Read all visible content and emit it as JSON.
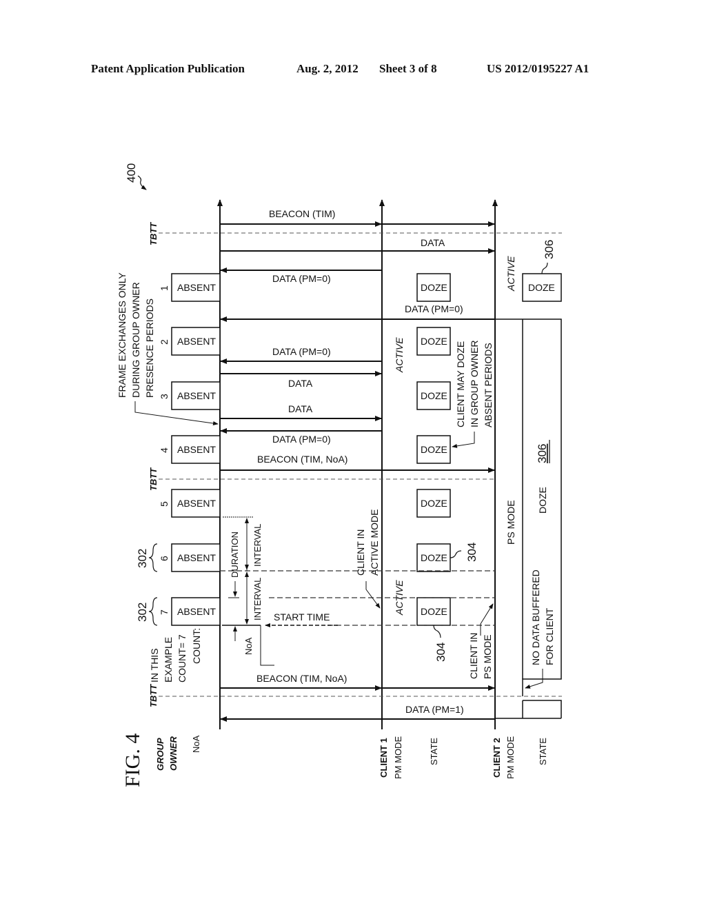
{
  "header": {
    "publication": "Patent Application Publication",
    "date": "Aug. 2, 2012",
    "sheet": "Sheet 3 of 8",
    "number": "US 2012/0195227 A1"
  },
  "figure": {
    "label": "FIG. 4",
    "ref_number": "400",
    "lanes": {
      "group_owner": [
        "GROUP",
        "OWNER"
      ],
      "noa": "NoA",
      "client1": "CLIENT 1",
      "client1_pm": "PM MODE",
      "client1_state": "STATE",
      "client2": "CLIENT 2",
      "client2_pm": "PM MODE",
      "client2_state": "STATE"
    },
    "tbtt": "TBTT",
    "absent_periods": [
      {
        "index": "1",
        "label": "ABSENT"
      },
      {
        "index": "2",
        "label": "ABSENT"
      },
      {
        "index": "3",
        "label": "ABSENT"
      },
      {
        "index": "4",
        "label": "ABSENT"
      },
      {
        "index": "5",
        "label": "ABSENT"
      },
      {
        "index": "6",
        "label": "ABSENT"
      },
      {
        "index": "7",
        "label": "ABSENT"
      }
    ],
    "doze_label": "DOZE",
    "messages": {
      "beacon_tim": "BEACON (TIM)",
      "data_top": "DATA",
      "data_pm0_1": "DATA (PM=0)",
      "data_pm0_c2": "DATA (PM=0)",
      "data_pm0_2": "DATA (PM=0)",
      "data_1": "DATA",
      "data_2": "DATA",
      "data_pm0_3": "DATA (PM=0)",
      "beacon_tim_noa_1": "BEACON (TIM, NoA)",
      "beacon_tim_noa_2": "BEACON (TIM, NoA)",
      "data_pm1": "DATA (PM=1)"
    },
    "annotations": {
      "frame_exchanges": [
        "FRAME EXCHANGES ONLY",
        "DURING GROUP OWNER",
        "PRESENCE PERIODS"
      ],
      "client_may_doze": [
        "CLIENT MAY DOZE",
        "IN GROUP OWNER",
        "ABSENT PERIODS"
      ],
      "client_active_mode": [
        "CLIENT IN",
        "ACTIVE MODE"
      ],
      "client_ps_mode": [
        "CLIENT IN",
        "PS MODE"
      ],
      "no_data_buffered": [
        "NO DATA BUFFERED",
        "FOR CLIENT"
      ],
      "example_count": [
        "IN THIS",
        "EXAMPLE",
        "COUNT= 7"
      ],
      "count": "COUNT:",
      "duration": "DURATION",
      "interval": "INTERVAL",
      "start_time": "START TIME",
      "noa_bracket": "NoA",
      "active": "ACTIVE",
      "ps_mode": "PS MODE",
      "doze_long": "DOZE",
      "ref_302": "302",
      "ref_304": "304",
      "ref_306": "306"
    }
  }
}
